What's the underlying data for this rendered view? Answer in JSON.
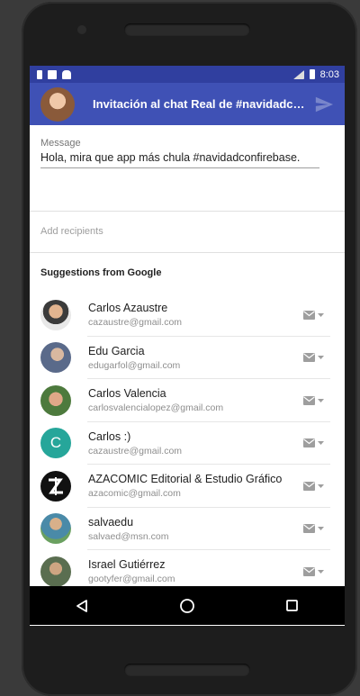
{
  "status_bar": {
    "time": "8:03"
  },
  "app_bar": {
    "title": "Invitación al chat Real de #navidadconfirebase"
  },
  "message": {
    "label": "Message",
    "text": "Hola, mira que app más chula #navidadconfirebase."
  },
  "recipients": {
    "placeholder": "Add recipients"
  },
  "suggestions": {
    "header": "Suggestions from Google",
    "contacts": [
      {
        "name": "Carlos Azaustre",
        "email": "cazaustre@gmail.com"
      },
      {
        "name": "Edu Garcia",
        "email": "edugarfol@gmail.com"
      },
      {
        "name": "Carlos Valencia",
        "email": "carlosvalencialopez@gmail.com"
      },
      {
        "name": "Carlos :)",
        "email": "cazaustre@gmail.com",
        "initial": "C"
      },
      {
        "name": "AZACOMIC Editorial & Estudio Gráfico",
        "email": "azacomic@gmail.com"
      },
      {
        "name": "salvaedu",
        "email": "salvaed@msn.com"
      },
      {
        "name": "Israel Gutiérrez",
        "email": "gootyfer@gmail.com"
      }
    ]
  },
  "colors": {
    "status_bar": "#303f9f",
    "app_bar": "#3f51b5",
    "initial_avatar": "#26a69a"
  },
  "icons": {
    "send": "send-icon",
    "mail": "mail-icon",
    "back": "back-icon",
    "home": "home-icon",
    "recents": "recents-icon"
  }
}
